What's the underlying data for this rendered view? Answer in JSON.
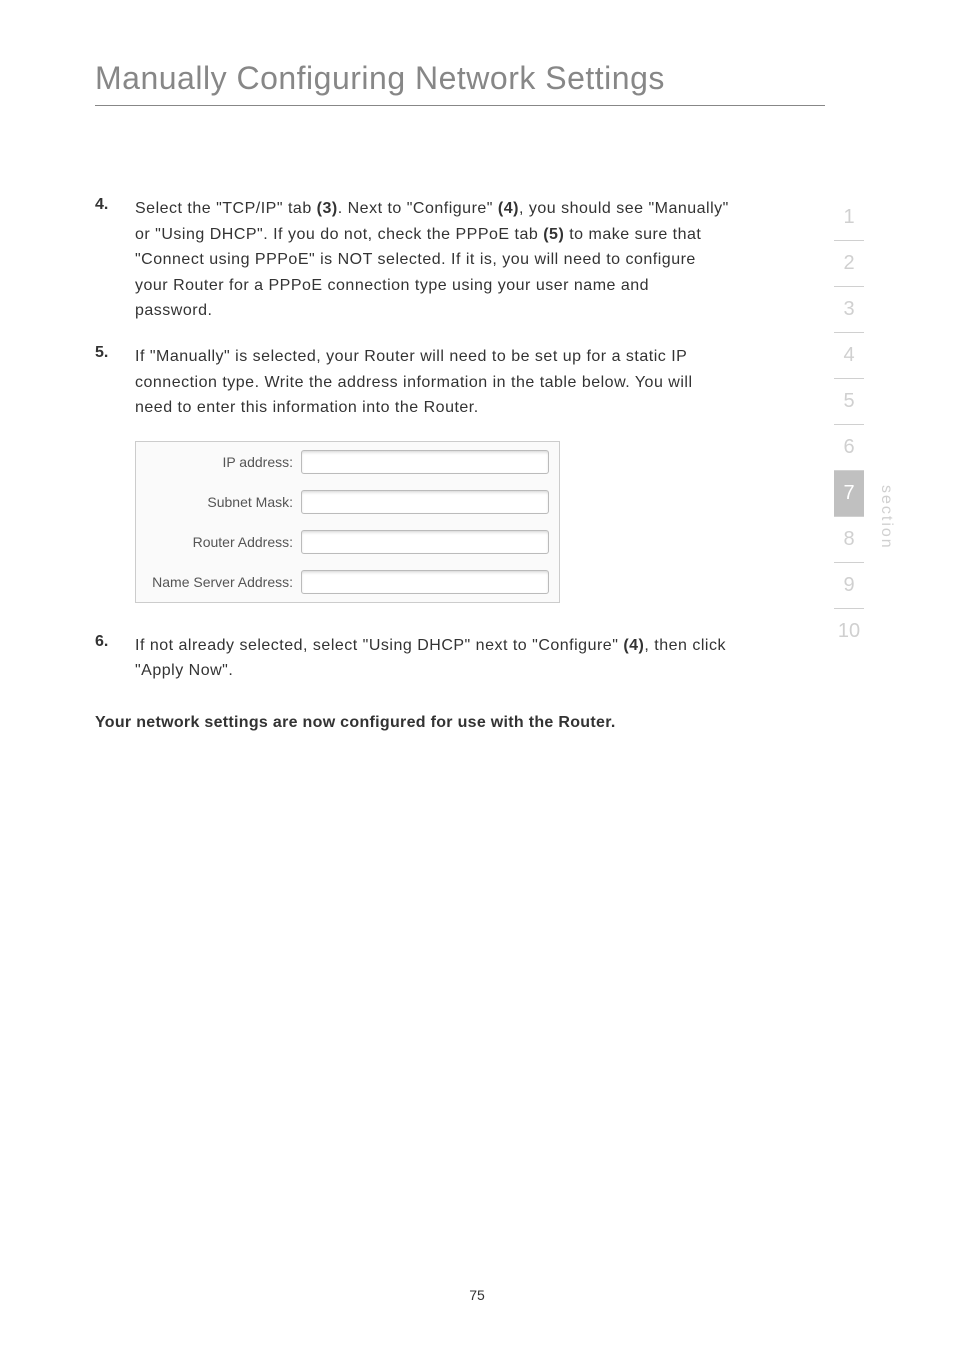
{
  "title": "Manually Configuring Network Settings",
  "items": [
    {
      "number": "4.",
      "text_parts": [
        {
          "text": "Select the \"TCP/IP\" tab ",
          "bold": false
        },
        {
          "text": "(3)",
          "bold": true
        },
        {
          "text": ". Next to \"Configure\" ",
          "bold": false
        },
        {
          "text": "(4)",
          "bold": true
        },
        {
          "text": ", you should see \"Manually\" or \"Using DHCP\". If you do not, check the PPPoE tab ",
          "bold": false
        },
        {
          "text": "(5)",
          "bold": true
        },
        {
          "text": " to make sure that \"Connect using PPPoE\" is NOT selected. If it is, you will need to configure your Router for a PPPoE connection type using your user name and password.",
          "bold": false
        }
      ]
    },
    {
      "number": "5.",
      "text_parts": [
        {
          "text": "If \"Manually\" is selected, your Router will need to be set up for a static IP connection type. Write the address information in the table below. You will need to enter this information into the Router.",
          "bold": false
        }
      ]
    },
    {
      "number": "6.",
      "text_parts": [
        {
          "text": "If not already selected, select \"Using DHCP\" next to \"Configure\" ",
          "bold": false
        },
        {
          "text": "(4)",
          "bold": true
        },
        {
          "text": ", then click \"Apply Now\".",
          "bold": false
        }
      ]
    }
  ],
  "table": {
    "rows": [
      {
        "label": "IP address:"
      },
      {
        "label": "Subnet Mask:"
      },
      {
        "label": "Router Address:"
      },
      {
        "label": "Name Server Address:"
      }
    ]
  },
  "footer": "Your network settings are now configured for use with the Router.",
  "sidebar": {
    "label": "section",
    "items": [
      "1",
      "2",
      "3",
      "4",
      "5",
      "6",
      "7",
      "8",
      "9",
      "10"
    ],
    "active": "7"
  },
  "page_number": "75"
}
